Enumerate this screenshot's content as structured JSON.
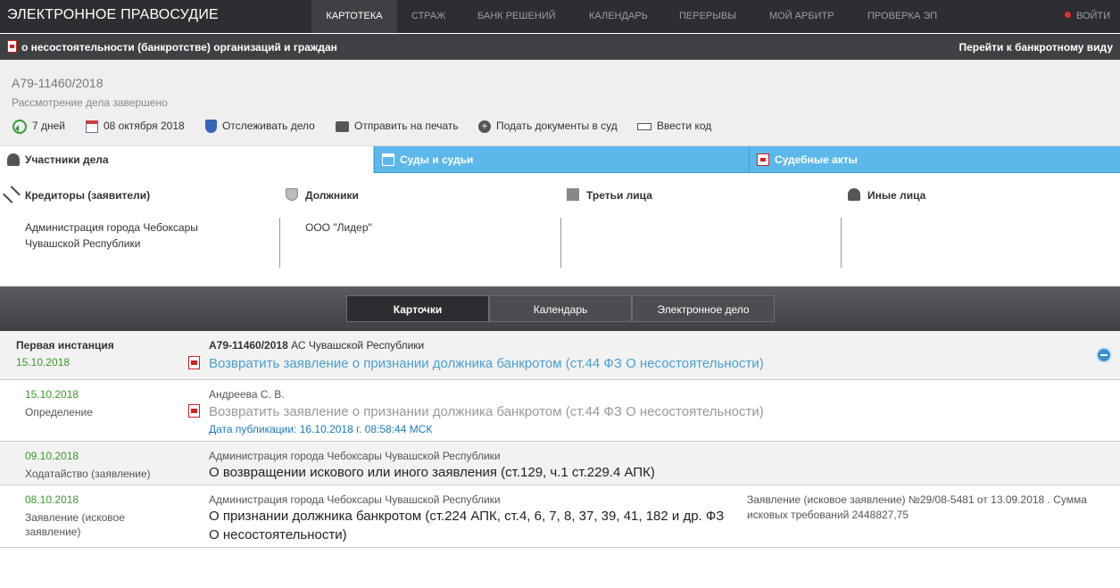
{
  "topnav": {
    "brand": "ЭЛЕКТРОННОЕ ПРАВОСУДИЕ",
    "items": [
      "КАРТОТЕКА",
      "СТРАЖ",
      "БАНК РЕШЕНИЙ",
      "КАЛЕНДАРЬ",
      "ПЕРЕРЫВЫ",
      "МОЙ АРБИТР",
      "ПРОВЕРКА ЭП"
    ],
    "active_item": "КАРТОТЕКА",
    "login": "ВОЙТИ"
  },
  "subheader": {
    "title": "о несостоятельности (банкротстве) организаций и граждан",
    "switch_link": "Перейти к банкротному виду"
  },
  "case": {
    "number": "А79-11460/2018",
    "status": "Рассмотрение дела завершено",
    "tools": {
      "days": "7 дней",
      "date": "08 октября 2018",
      "track": "Отслеживать дело",
      "print": "Отправить на печать",
      "submit": "Подать документы в суд",
      "code": "Ввести код"
    }
  },
  "participant_tabs": [
    "Участники дела",
    "Суды и судьи",
    "Судебные акты"
  ],
  "participants": {
    "creditors": {
      "title": "Кредиторы (заявители)",
      "names": [
        "Администрация города Чебоксары",
        "Чувашской Республики"
      ]
    },
    "debtors": {
      "title": "Должники",
      "names": [
        "ООО \"Лидер\""
      ]
    },
    "third": {
      "title": "Третьи лица",
      "names": []
    },
    "other": {
      "title": "Иные лица",
      "names": []
    }
  },
  "view_switch": [
    "Карточки",
    "Календарь",
    "Электронное дело"
  ],
  "instance": {
    "title": "Первая инстанция",
    "date": "15.10.2018",
    "case_number": "А79-11460/2018",
    "court": "АС Чувашской Республики",
    "link": "Возвратить заявление о признании должника банкротом (ст.44 ФЗ О несостоятельности)"
  },
  "documents": [
    {
      "date": "15.10.2018",
      "type": "Определение",
      "author": "Андреева С. В.",
      "title": "Возвратить заявление о признании должника банкротом (ст.44 ФЗ О несостоятельности)",
      "publication": "Дата публикации: 16.10.2018 г. 08:58:44 МСК",
      "note": ""
    },
    {
      "date": "09.10.2018",
      "type": "Ходатайство (заявление)",
      "author": "Администрация города Чебоксары Чувашской Республики",
      "title": "О возвращении искового или иного заявления (ст.129, ч.1 ст.229.4 АПК)",
      "publication": "",
      "note": ""
    },
    {
      "date": "08.10.2018",
      "type": "Заявление (исковое заявление)",
      "author": "Администрация города Чебоксары Чувашской Республики",
      "title": "О признании должника банкротом (ст.224 АПК, ст.4, 6, 7, 8, 37, 39, 41, 182 и др. ФЗ О несостоятельности)",
      "publication": "",
      "note": "Заявление (исковое заявление) №29/08-5481 от 13.09.2018 . Сумма исковых требований 2448827,75"
    }
  ],
  "colors": {
    "topbar": "#2d2e31",
    "accent_tab": "#5cb8ea",
    "link": "#4a9fd0",
    "date_green": "#3c9a2c"
  }
}
